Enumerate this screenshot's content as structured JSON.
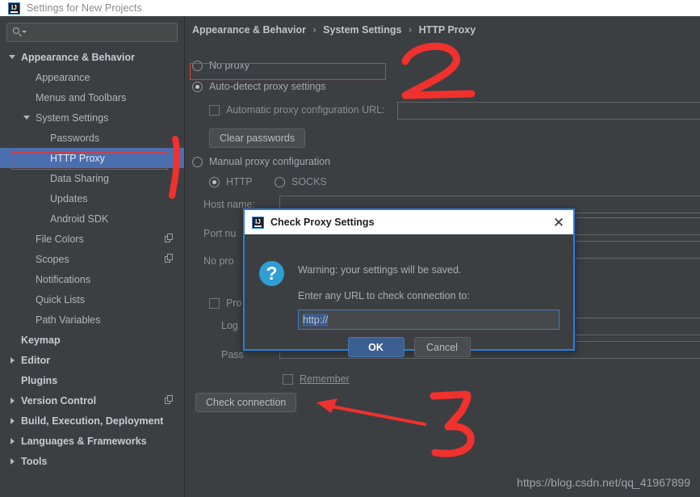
{
  "window": {
    "title": "Settings for New Projects",
    "logo_icon": "intellij-idea-logo-icon"
  },
  "search": {
    "value": "",
    "placeholder": "",
    "icon": "search-icon"
  },
  "sidebar": {
    "items": [
      {
        "label": "Appearance & Behavior",
        "indent": 0,
        "twisty": "down",
        "bold": true,
        "selected": false,
        "copy": false
      },
      {
        "label": "Appearance",
        "indent": 1,
        "twisty": "none",
        "bold": false,
        "selected": false,
        "copy": false
      },
      {
        "label": "Menus and Toolbars",
        "indent": 1,
        "twisty": "none",
        "bold": false,
        "selected": false,
        "copy": false
      },
      {
        "label": "System Settings",
        "indent": 1,
        "twisty": "down",
        "bold": false,
        "selected": false,
        "copy": false
      },
      {
        "label": "Passwords",
        "indent": 2,
        "twisty": "none",
        "bold": false,
        "selected": false,
        "copy": false
      },
      {
        "label": "HTTP Proxy",
        "indent": 2,
        "twisty": "none",
        "bold": false,
        "selected": true,
        "copy": false
      },
      {
        "label": "Data Sharing",
        "indent": 2,
        "twisty": "none",
        "bold": false,
        "selected": false,
        "copy": false
      },
      {
        "label": "Updates",
        "indent": 2,
        "twisty": "none",
        "bold": false,
        "selected": false,
        "copy": false
      },
      {
        "label": "Android SDK",
        "indent": 2,
        "twisty": "none",
        "bold": false,
        "selected": false,
        "copy": false
      },
      {
        "label": "File Colors",
        "indent": 1,
        "twisty": "none",
        "bold": false,
        "selected": false,
        "copy": true
      },
      {
        "label": "Scopes",
        "indent": 1,
        "twisty": "none",
        "bold": false,
        "selected": false,
        "copy": true
      },
      {
        "label": "Notifications",
        "indent": 1,
        "twisty": "none",
        "bold": false,
        "selected": false,
        "copy": false
      },
      {
        "label": "Quick Lists",
        "indent": 1,
        "twisty": "none",
        "bold": false,
        "selected": false,
        "copy": false
      },
      {
        "label": "Path Variables",
        "indent": 1,
        "twisty": "none",
        "bold": false,
        "selected": false,
        "copy": false
      },
      {
        "label": "Keymap",
        "indent": 0,
        "twisty": "none",
        "bold": true,
        "selected": false,
        "copy": false
      },
      {
        "label": "Editor",
        "indent": 0,
        "twisty": "right",
        "bold": true,
        "selected": false,
        "copy": false
      },
      {
        "label": "Plugins",
        "indent": 0,
        "twisty": "none",
        "bold": true,
        "selected": false,
        "copy": false
      },
      {
        "label": "Version Control",
        "indent": 0,
        "twisty": "right",
        "bold": true,
        "selected": false,
        "copy": true
      },
      {
        "label": "Build, Execution, Deployment",
        "indent": 0,
        "twisty": "right",
        "bold": true,
        "selected": false,
        "copy": false
      },
      {
        "label": "Languages & Frameworks",
        "indent": 0,
        "twisty": "right",
        "bold": true,
        "selected": false,
        "copy": false
      },
      {
        "label": "Tools",
        "indent": 0,
        "twisty": "right",
        "bold": true,
        "selected": false,
        "copy": false
      }
    ]
  },
  "main": {
    "breadcrumb": {
      "part1": "Appearance & Behavior",
      "part2": "System Settings",
      "part3": "HTTP Proxy",
      "separator": "›"
    },
    "no_proxy_label": "No proxy",
    "auto_detect_label": "Auto-detect proxy settings",
    "auto_config_url_label": "Automatic proxy configuration URL:",
    "clear_passwords_label": "Clear passwords",
    "manual_proxy_label": "Manual proxy configuration",
    "http_label": "HTTP",
    "socks_label": "SOCKS",
    "host_name_label": "Host name:",
    "host_name_value": "",
    "port_number_label": "Port nu",
    "no_proxy_for_label": "No pro",
    "proxy_auth_label": "Pro",
    "login_label": "Log",
    "password_label": "Pass",
    "remember_label": "Remember",
    "check_connection_label": "Check connection",
    "auto_config_url_value": "",
    "selected_proxy_mode": "auto-detect",
    "selected_protocol": "HTTP"
  },
  "dialog": {
    "title": "Check Proxy Settings",
    "logo_icon": "intellij-idea-logo-icon",
    "close_icon": "✕",
    "question_icon": "?",
    "message_line1": "Warning: your settings will be saved.",
    "message_line2": "Enter any URL to check connection to:",
    "url_value": "http://",
    "ok_label": "OK",
    "cancel_label": "Cancel"
  },
  "annotations": {
    "mark_1": "1",
    "mark_2": "2",
    "mark_3": "3",
    "arrow": "left-arrow",
    "color": "#f0312e"
  },
  "watermark": "https://blog.csdn.net/qq_41967899",
  "colors": {
    "background": "#3c3f41",
    "selection": "#4b6eaf",
    "accent_blue": "#2d7ddd",
    "annotation_red": "#f0312e",
    "titlebar": "#ffffff"
  }
}
